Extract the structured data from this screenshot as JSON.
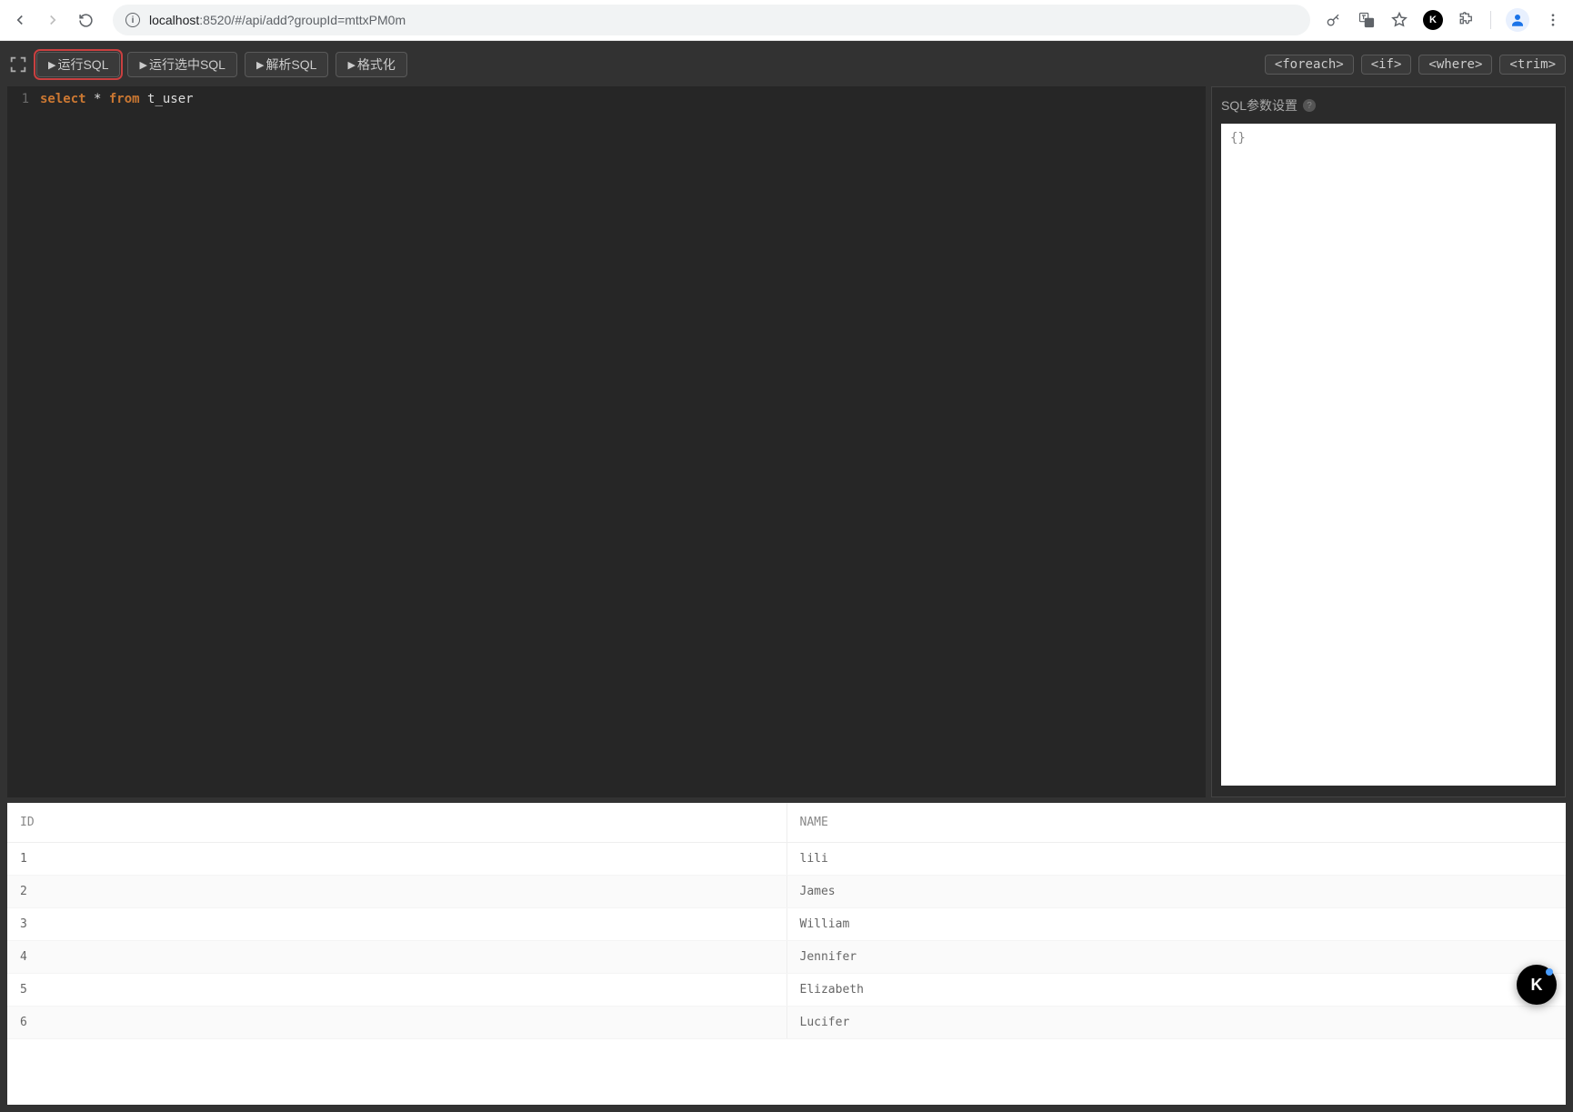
{
  "browser": {
    "url_host": "localhost",
    "url_port_path": ":8520/#/api/add?groupId=mttxPM0m"
  },
  "toolbar": {
    "run_sql": "运行SQL",
    "run_selected_sql": "运行选中SQL",
    "parse_sql": "解析SQL",
    "format": "格式化"
  },
  "tags": {
    "foreach": "<foreach>",
    "if": "<if>",
    "where": "<where>",
    "trim": "<trim>"
  },
  "editor": {
    "line_number": "1",
    "kw_select": "select",
    "star": " * ",
    "kw_from": "from",
    "table": " t_user"
  },
  "params": {
    "title": "SQL参数设置",
    "value": "{}"
  },
  "results": {
    "columns": [
      "ID",
      "NAME"
    ],
    "rows": [
      {
        "id": "1",
        "name": "lili"
      },
      {
        "id": "2",
        "name": "James"
      },
      {
        "id": "3",
        "name": "William"
      },
      {
        "id": "4",
        "name": "Jennifer"
      },
      {
        "id": "5",
        "name": "Elizabeth"
      },
      {
        "id": "6",
        "name": "Lucifer"
      }
    ]
  },
  "float_btn": "K"
}
